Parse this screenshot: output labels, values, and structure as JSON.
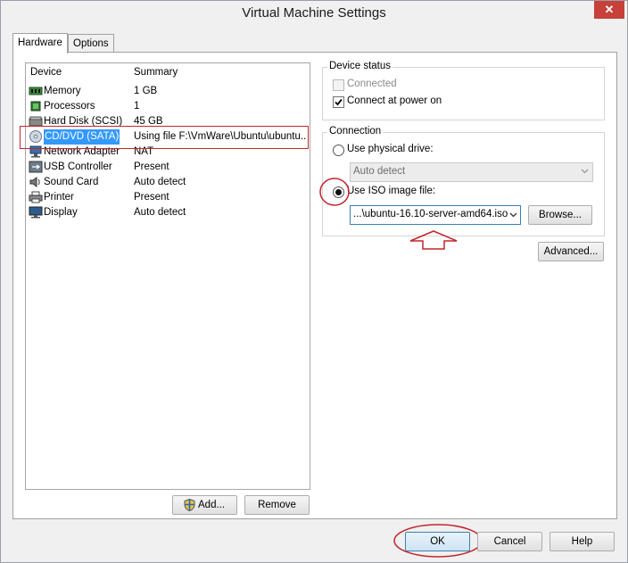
{
  "window": {
    "title": "Virtual Machine Settings",
    "close_glyph": "✕"
  },
  "tabs": [
    {
      "label": "Hardware",
      "active": true
    },
    {
      "label": "Options",
      "active": false
    }
  ],
  "device_list": {
    "columns": [
      "Device",
      "Summary"
    ],
    "rows": [
      {
        "icon": "memory-icon",
        "device": "Memory",
        "summary": "1 GB"
      },
      {
        "icon": "processor-icon",
        "device": "Processors",
        "summary": "1"
      },
      {
        "icon": "hard-disk-icon",
        "device": "Hard Disk (SCSI)",
        "summary": "45 GB"
      },
      {
        "icon": "cd-dvd-icon",
        "device": "CD/DVD (SATA)",
        "summary": "Using file F:\\VmWare\\Ubuntu\\ubuntu...",
        "selected": true
      },
      {
        "icon": "network-adapter-icon",
        "device": "Network Adapter",
        "summary": "NAT"
      },
      {
        "icon": "usb-icon",
        "device": "USB Controller",
        "summary": "Present"
      },
      {
        "icon": "sound-card-icon",
        "device": "Sound Card",
        "summary": "Auto detect"
      },
      {
        "icon": "printer-icon",
        "device": "Printer",
        "summary": "Present"
      },
      {
        "icon": "display-icon",
        "device": "Display",
        "summary": "Auto detect"
      }
    ]
  },
  "left_buttons": {
    "add": "Add...",
    "remove": "Remove"
  },
  "device_status": {
    "label": "Device status",
    "connected": {
      "label": "Connected",
      "checked": false,
      "disabled": true
    },
    "connect_at_power_on": {
      "label": "Connect at power on",
      "checked": true
    }
  },
  "connection": {
    "label": "Connection",
    "use_physical_drive": {
      "label": "Use physical drive:",
      "selected": false
    },
    "physical_drive_value": "Auto detect",
    "use_iso": {
      "label": "Use ISO image file:",
      "selected": true
    },
    "iso_path": "...\\ubuntu-16.10-server-amd64.iso",
    "browse": "Browse..."
  },
  "advanced": "Advanced...",
  "footer": {
    "ok": "OK",
    "cancel": "Cancel",
    "help": "Help"
  },
  "colors": {
    "annotation_red": "#c1272d",
    "selection_blue": "#3399ff"
  }
}
